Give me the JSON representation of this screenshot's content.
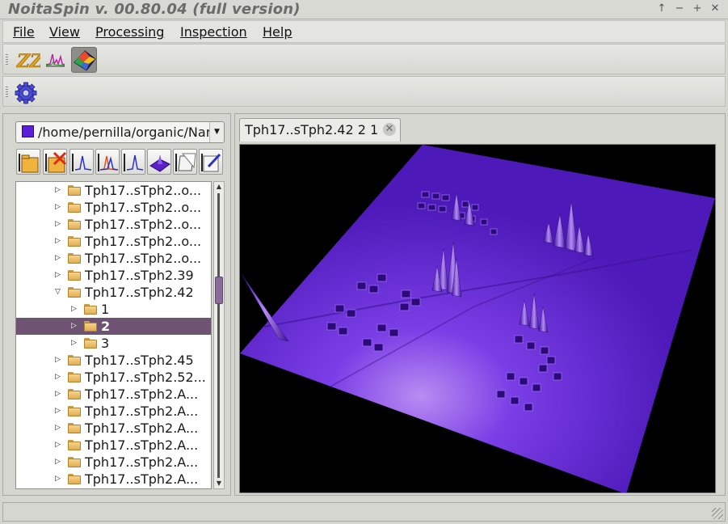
{
  "window": {
    "title": "NoitaSpin v. 00.80.04 (full version)",
    "controls": [
      "↑",
      "−",
      "+",
      "✕"
    ]
  },
  "menubar": {
    "items": [
      {
        "label": "File"
      },
      {
        "label": "View"
      },
      {
        "label": "Processing"
      },
      {
        "label": "Inspection"
      },
      {
        "label": "Help"
      }
    ]
  },
  "toolbar1": {
    "buttons": [
      {
        "icon": "zz-icon"
      },
      {
        "icon": "spectrum-icon"
      },
      {
        "icon": "3d-plot-icon",
        "active": true
      }
    ]
  },
  "toolbar2": {
    "buttons": [
      {
        "icon": "gear-icon"
      }
    ]
  },
  "browser": {
    "path": "/home/pernilla/organic/Nar",
    "path_color": "#5a1fd6",
    "icon_buttons": [
      "open-folder-icon",
      "close-folder-icon",
      "peak-icon",
      "multi-peak-icon",
      "single-peak-icon",
      "surface-icon",
      "copy-icon",
      "edit-icon"
    ],
    "tree": [
      {
        "label": "Tph17..sTph2..o...",
        "level": 0,
        "state": "collapsed"
      },
      {
        "label": "Tph17..sTph2..o...",
        "level": 0,
        "state": "collapsed"
      },
      {
        "label": "Tph17..sTph2..o...",
        "level": 0,
        "state": "collapsed"
      },
      {
        "label": "Tph17..sTph2..o...",
        "level": 0,
        "state": "collapsed"
      },
      {
        "label": "Tph17..sTph2..o...",
        "level": 0,
        "state": "collapsed"
      },
      {
        "label": "Tph17..sTph2.39",
        "level": 0,
        "state": "collapsed"
      },
      {
        "label": "Tph17..sTph2.42",
        "level": 0,
        "state": "expanded"
      },
      {
        "label": "1",
        "level": 1,
        "state": "collapsed"
      },
      {
        "label": "2",
        "level": 1,
        "state": "collapsed",
        "selected": true
      },
      {
        "label": "3",
        "level": 1,
        "state": "collapsed"
      },
      {
        "label": "Tph17..sTph2.45",
        "level": 0,
        "state": "collapsed"
      },
      {
        "label": "Tph17..sTph2.52...",
        "level": 0,
        "state": "collapsed"
      },
      {
        "label": "Tph17..sTph2.A...",
        "level": 0,
        "state": "collapsed"
      },
      {
        "label": "Tph17..sTph2.A...",
        "level": 0,
        "state": "collapsed"
      },
      {
        "label": "Tph17..sTph2.A...",
        "level": 0,
        "state": "collapsed"
      },
      {
        "label": "Tph17..sTph2.A...",
        "level": 0,
        "state": "collapsed"
      },
      {
        "label": "Tph17..sTph2.A...",
        "level": 0,
        "state": "collapsed"
      },
      {
        "label": "Tph17..sTph2.A...",
        "level": 0,
        "state": "collapsed"
      }
    ]
  },
  "document": {
    "tab_label": "Tph17..sTph2.42 2 1",
    "close_glyph": "✕",
    "surface_color": "#5b1ec8",
    "background_color": "#000000"
  }
}
